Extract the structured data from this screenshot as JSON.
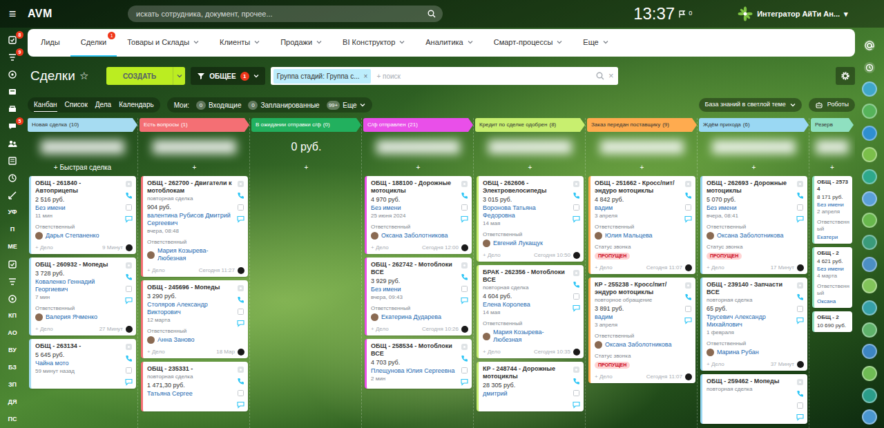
{
  "topbar": {
    "menu_icon": "≡",
    "logo": "AVM",
    "search_placeholder": "искать сотрудника, документ, прочее...",
    "time": "13:37",
    "flag_count": "0",
    "user": "Интегратор АйТи Ан...",
    "user_caret": "▾"
  },
  "left_sidebar": [
    {
      "kind": "icon",
      "badge": "8"
    },
    {
      "kind": "icon",
      "badge": "9"
    },
    {
      "kind": "icon"
    },
    {
      "kind": "icon"
    },
    {
      "kind": "icon"
    },
    {
      "kind": "icon",
      "badge": "5"
    },
    {
      "kind": "icon"
    },
    {
      "kind": "icon"
    },
    {
      "kind": "icon"
    },
    {
      "kind": "icon"
    },
    {
      "kind": "text",
      "label": "УФ"
    },
    {
      "kind": "text",
      "label": "П"
    },
    {
      "kind": "text",
      "label": "МЕ"
    },
    {
      "kind": "icon"
    },
    {
      "kind": "icon"
    },
    {
      "kind": "icon"
    },
    {
      "kind": "text",
      "label": "КП"
    },
    {
      "kind": "text",
      "label": "АО"
    },
    {
      "kind": "text",
      "label": "ВУ"
    },
    {
      "kind": "text",
      "label": "БЗ"
    },
    {
      "kind": "text",
      "label": "ЗП"
    },
    {
      "kind": "text",
      "label": "ДЯ"
    },
    {
      "kind": "text",
      "label": "ПС"
    }
  ],
  "right_sidebar": [
    {
      "kind": "icon"
    },
    {
      "kind": "icon"
    },
    {
      "kind": "avatar",
      "color": "#3fa7c9"
    },
    {
      "kind": "avatar",
      "color": "#56b35a"
    },
    {
      "kind": "avatar",
      "color": "#2f8fd0"
    },
    {
      "kind": "avatar",
      "color": "#7bbf4a"
    },
    {
      "kind": "avatar",
      "color": "#2ea88b"
    },
    {
      "kind": "avatar",
      "color": "#5aa0d8"
    },
    {
      "kind": "avatar",
      "color": "#68b84c"
    },
    {
      "kind": "avatar",
      "color": "#3a9b7a"
    },
    {
      "kind": "avatar",
      "color": "#4c8fc4"
    },
    {
      "kind": "avatar",
      "color": "#82c45a"
    },
    {
      "kind": "avatar",
      "color": "#36a0a8"
    },
    {
      "kind": "avatar",
      "color": "#5fb26b"
    },
    {
      "kind": "avatar",
      "color": "#3d86c2"
    },
    {
      "kind": "avatar",
      "color": "#6fbc54"
    },
    {
      "kind": "avatar",
      "color": "#2b9d8a"
    },
    {
      "kind": "avatar",
      "color": "#4a97cf"
    }
  ],
  "nav": [
    {
      "label": "Лиды",
      "selected": false,
      "dropdown": false
    },
    {
      "label": "Сделки",
      "selected": true,
      "dropdown": false,
      "badge": "1"
    },
    {
      "label": "Товары и Склады",
      "selected": false,
      "dropdown": true
    },
    {
      "label": "Клиенты",
      "selected": false,
      "dropdown": true
    },
    {
      "label": "Продажи",
      "selected": false,
      "dropdown": true
    },
    {
      "label": "BI Конструктор",
      "selected": false,
      "dropdown": true
    },
    {
      "label": "Аналитика",
      "selected": false,
      "dropdown": true
    },
    {
      "label": "Смарт-процессы",
      "selected": false,
      "dropdown": true
    },
    {
      "label": "Еще",
      "selected": false,
      "dropdown": true
    }
  ],
  "toolbar": {
    "title": "Сделки",
    "star": "☆",
    "create": "СОЗДАТЬ",
    "filter": "ОБЩЕЕ",
    "filter_badge": "1",
    "chip": "Группа стадий: Группа с...",
    "chip_close": "×",
    "search_placeholder": "+ поиск",
    "clear": "×"
  },
  "views": {
    "tabs": [
      {
        "label": "Канбан",
        "selected": true
      },
      {
        "label": "Список",
        "selected": false
      },
      {
        "label": "Дела",
        "selected": false
      },
      {
        "label": "Календарь",
        "selected": false
      }
    ],
    "my_label": "Мои:",
    "counters": [
      {
        "count": "0",
        "label": "Входящие",
        "dropdown": false
      },
      {
        "count": "0",
        "label": "Запланированные",
        "dropdown": false
      },
      {
        "count": "99+",
        "label": "Еще",
        "dropdown": true
      }
    ],
    "knowledge": "База знаний в светлой теме",
    "robots": "Роботы"
  },
  "stages": [
    {
      "name": "Новая сделка",
      "count": "(10)",
      "color": "#a6dcf2",
      "add": "+ Быстрая сделка",
      "truncated": false,
      "cards": [
        {
          "title": "ОБЩ - 261840 - Автоприцепы",
          "amount": "2 516 руб.",
          "client": "Без имени",
          "date": "11 мин",
          "responsible_label": "Ответственный",
          "responsible": "Дарья Степаненко",
          "activity": "+ Дело",
          "time": "9 Минут"
        },
        {
          "title": "ОБЩ - 260932 - Мопеды",
          "amount": "3 728 руб.",
          "client": "Коваленко Геннадий Георгиевич",
          "date": "7 мин",
          "responsible_label": "Ответственный",
          "responsible": "Валерия Ячменко",
          "activity": "+ Дело",
          "time": "27 Минут"
        },
        {
          "title": "ОБЩ - 263134 -",
          "amount": "5 645 руб.",
          "client": "Чайна мото",
          "date": "59 минут назад"
        }
      ]
    },
    {
      "name": "Есть вопросы",
      "count": "(1)",
      "color": "#f46f74",
      "add": "+",
      "truncated": false,
      "cards": [
        {
          "title": "ОБЩ - 262700 - Двигатели к мотоблокам",
          "repeat": "повторная сделка",
          "amount": "904 руб.",
          "client": "валентина Рубисов Дмитрий Сергеевич",
          "date": "вчера, 08:48",
          "responsible_label": "Ответственный",
          "responsible": "Мария Козырева-Любезная",
          "activity": "+ Дело",
          "time": "Сегодня 11:27"
        },
        {
          "title": "ОБЩ - 245696 - Мопеды",
          "amount": "3 290 руб.",
          "client": "Столяров Александр Викторович",
          "date": "12 марта",
          "responsible_label": "Ответственный",
          "responsible": "Анна Заново",
          "activity": "+ Дело",
          "time": "18 Мар"
        },
        {
          "title": "ОБЩ - 235331 -",
          "repeat": "повторная сделка",
          "amount": "1 471,30 руб.",
          "client": "Татьяна Сергее"
        }
      ]
    },
    {
      "name": "В ожидании отправки с/ф",
      "count": "(0)",
      "color": "#22b05e",
      "total": "0 руб.",
      "add": "+",
      "truncated": false,
      "cards": []
    },
    {
      "name": "С/ф отправлен",
      "count": "(21)",
      "color": "#e94fe9",
      "add": "+",
      "truncated": false,
      "cards": [
        {
          "title": "ОБЩ - 188100 - Дорожные мотоциклы",
          "amount": "4 970 руб.",
          "client": "Без имени",
          "date": "25 июня 2024",
          "responsible_label": "Ответственный",
          "responsible": "Оксана Заболотникова",
          "activity": "+ Дело",
          "time": "Сегодня 12:00"
        },
        {
          "title": "ОБЩ - 262742 - Мотоблоки ВСЕ",
          "amount": "3 929 руб.",
          "client": "Без имени",
          "date": "вчера, 09:43",
          "responsible_label": "Ответственный",
          "responsible": "Екатерина Дударева",
          "activity": "+ Дело",
          "time": "Сегодня 10:26"
        },
        {
          "title": "ОБЩ - 258534 - Мотоблоки ВСЕ",
          "amount": "4 703 руб.",
          "client": "Плещунова Юлия Сергеевна",
          "date": "2 мин"
        }
      ]
    },
    {
      "name": "Кредит по сделке одобрен",
      "count": "(8)",
      "color": "#c8ef6f",
      "add": "+",
      "truncated": false,
      "cards": [
        {
          "title": "ОБЩ - 262606 - Электровелосипеды",
          "amount": "3 015 руб.",
          "client": "Воронова Татьяна Федоровна",
          "date": "14 мая",
          "responsible_label": "Ответственный",
          "responsible": "Евгений Лукащук",
          "activity": "+ Дело",
          "time": "Сегодня 10:50"
        },
        {
          "title": "БРАК - 262356 - Мотоблоки ВСЕ",
          "repeat": "повторная сделка",
          "amount": "4 604 руб.",
          "client": "Елена Королева",
          "date": "14 мая",
          "responsible_label": "Ответственный",
          "responsible": "Мария Козырева-Любезная",
          "activity": "+ Дело",
          "time": "Сегодня 10:35"
        },
        {
          "title": "КР - 248744 - Дорожные мотоциклы",
          "amount": "28 305 руб.",
          "client": "дмитрий"
        }
      ]
    },
    {
      "name": "Заказ передан поставщику",
      "count": "(9)",
      "color": "#ffab4f",
      "add": "+",
      "truncated": false,
      "cards": [
        {
          "title": "ОБЩ - 251662 - Кросс/пит/эндуро мотоциклы",
          "amount": "4 842 руб.",
          "client": "вадим",
          "date": "3 апреля",
          "responsible_label": "Ответственный",
          "responsible": "Юлия Мальцева",
          "call_label": "Статус звонка",
          "call_status": "ПРОПУЩЕН",
          "activity": "+ Дело",
          "time": "Сегодня 11:07"
        },
        {
          "title": "КР - 255238 - Кросс/пит/эндуро мотоциклы",
          "repeat": "повторное обращение",
          "amount": "3 891 руб.",
          "client": "вадим",
          "date": "3 апреля",
          "responsible_label": "Ответственный",
          "responsible": "Оксана Заболотникова",
          "call_label": "Статус звонка",
          "call_status": "ПРОПУЩЕН",
          "activity": "+ Дело",
          "time": "Сегодня 11:07"
        }
      ]
    },
    {
      "name": "Ждём прихода",
      "count": "(6)",
      "color": "#9ad8f3",
      "add": "+",
      "truncated": false,
      "cards": [
        {
          "title": "ОБЩ - 262693 - Дорожные мотоциклы",
          "amount": "5 070 руб.",
          "client": "Без имени",
          "date": "вчера, 08:41",
          "responsible_label": "Ответственный",
          "responsible": "Оксана Заболотникова",
          "call_label": "Статус звонка",
          "call_status": "ПРОПУЩЕН",
          "activity": "+ Дело",
          "time": "17 Минут"
        },
        {
          "title": "ОБЩ - 239140 - Запчасти ВСЕ",
          "repeat": "повторная сделка",
          "amount": "65 руб.",
          "client": "Трусевич Александр Михайлович",
          "date": "1 февраля",
          "responsible_label": "Ответственный",
          "responsible": "Марина Рубан",
          "activity": "+ Дело",
          "time": "37 Минут"
        },
        {
          "title": "ОБЩ - 259462 - Мопеды",
          "repeat": "повторная сделка"
        }
      ]
    },
    {
      "name": "Резерв",
      "count": "",
      "color": "#8fe0c0",
      "add": "+",
      "truncated": true,
      "cards": [
        {
          "title": "ОБЩ - 25734",
          "amount": "8 171 руб.",
          "client": "Без имени",
          "date": "2 апреля",
          "responsible_label": "Ответственный",
          "responsible": "Екатери"
        },
        {
          "title": "ОБЩ - 2",
          "amount": "4 621 руб.",
          "client": "Без имени",
          "date": "4 марта",
          "responsible_label": "Ответственный",
          "responsible": "Оксана"
        },
        {
          "title": "ОБЩ - 2",
          "amount": "10 690 руб."
        }
      ]
    }
  ]
}
